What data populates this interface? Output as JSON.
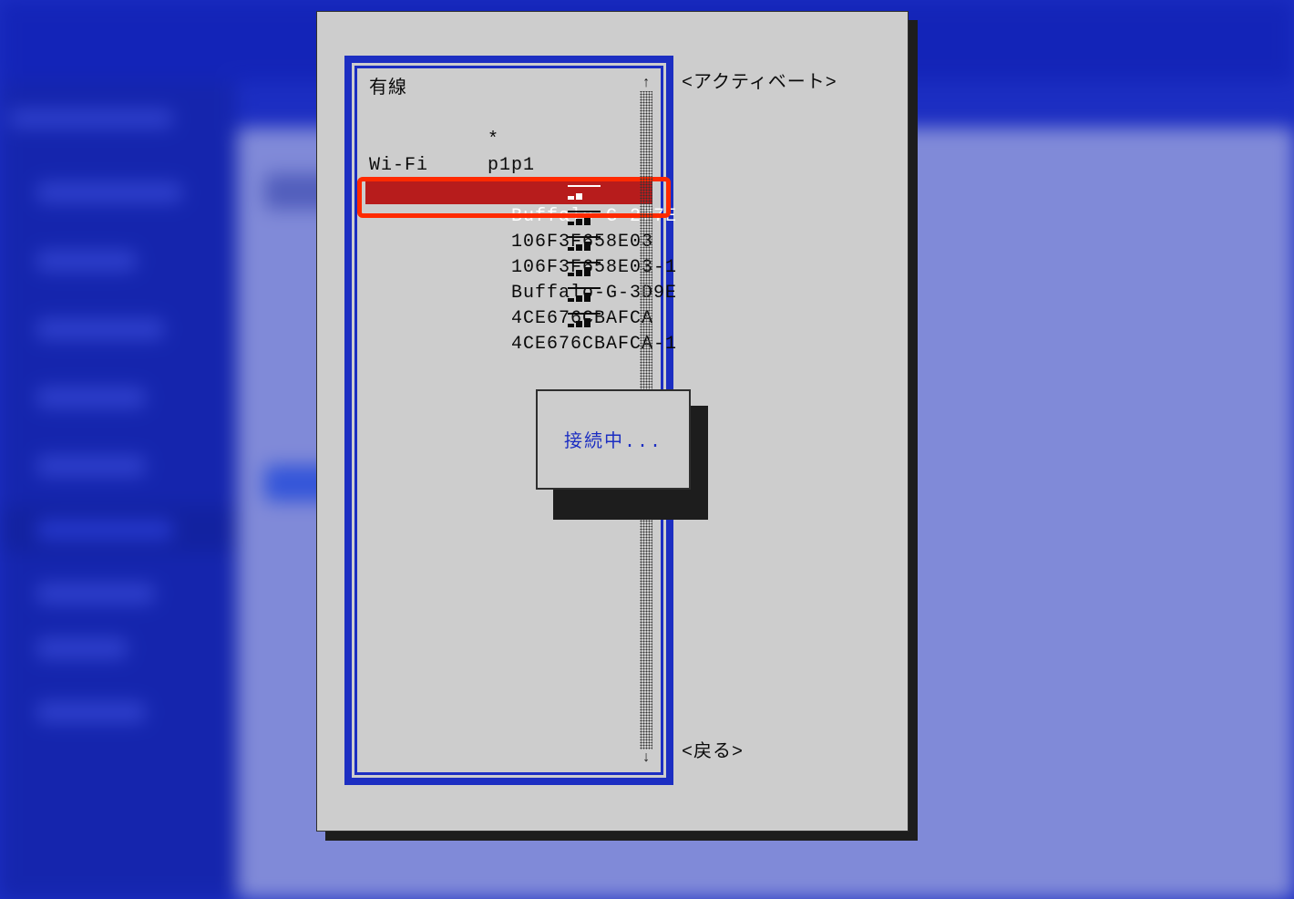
{
  "sections": {
    "wired": {
      "title": "有線",
      "items": [
        {
          "label": "p1p1",
          "active": true
        }
      ]
    },
    "wifi": {
      "title": "Wi-Fi",
      "items": [
        {
          "label": "Buffalo-G-277E",
          "selected": true,
          "signal_level": 2
        },
        {
          "label": "106F3F658E03",
          "signal_level": 3
        },
        {
          "label": "106F3F658E03-1",
          "signal_level": 3
        },
        {
          "label": "Buffalo-G-3D9E",
          "signal_level": 3
        },
        {
          "label": "4CE676CBAFCA",
          "signal_level": 3
        },
        {
          "label": "4CE676CBAFCA-1",
          "signal_level": 3
        }
      ]
    }
  },
  "buttons": {
    "activate": "<アクティベート>",
    "back": "<戻る>"
  },
  "popup": {
    "message": "接続中..."
  },
  "scroll": {
    "up": "↑",
    "down": "↓"
  },
  "active_mark": "*"
}
